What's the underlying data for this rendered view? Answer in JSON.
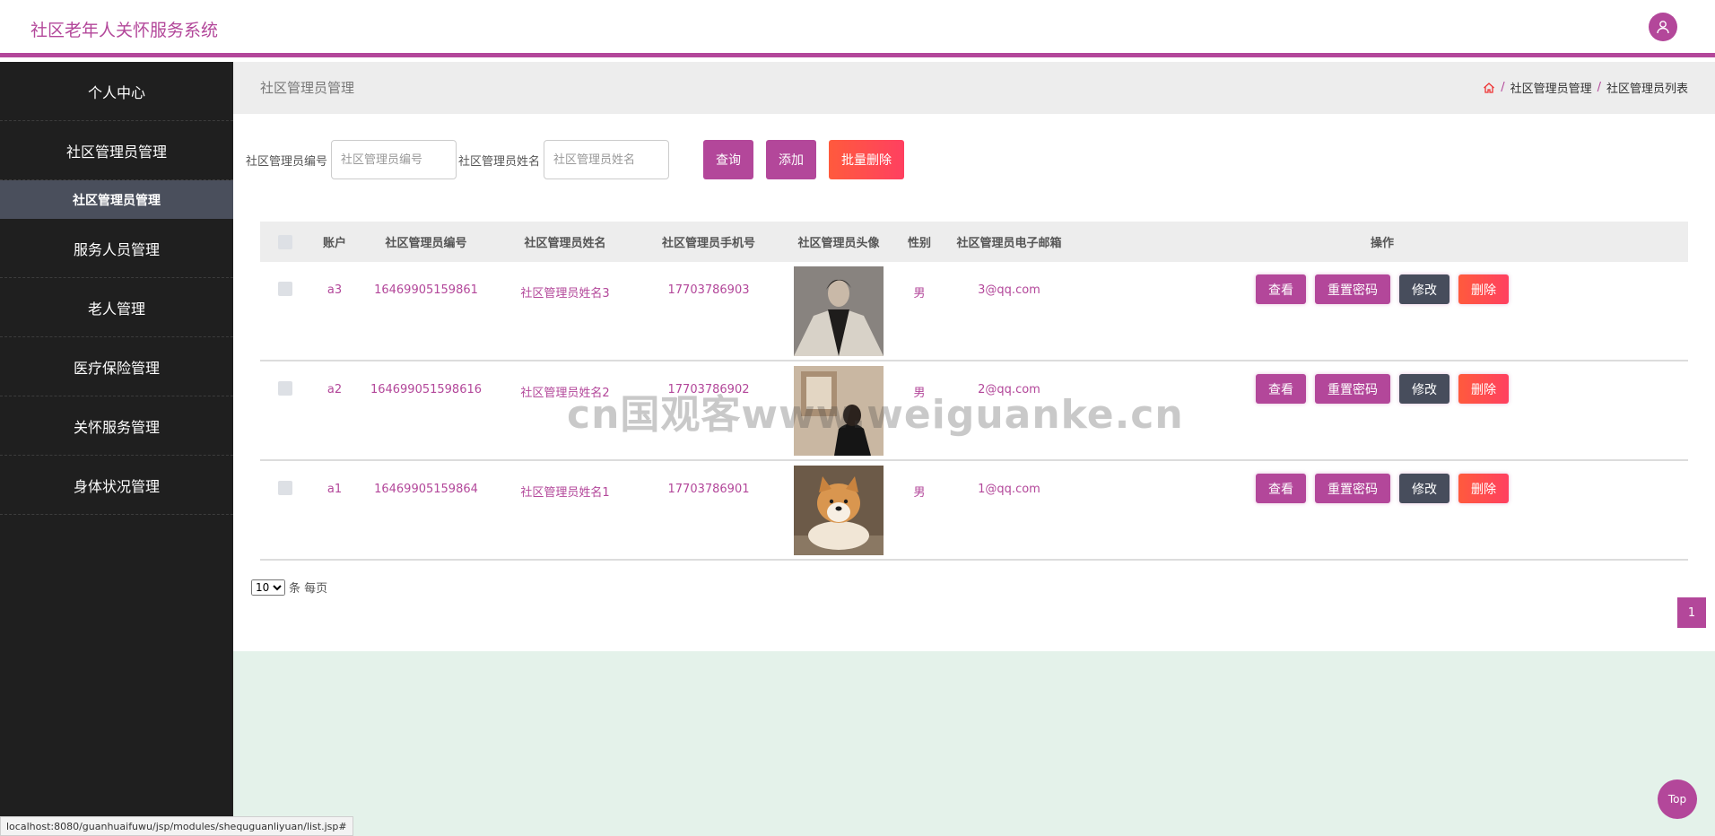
{
  "header": {
    "title": "社区老年人关怀服务系统",
    "avatar_icon": "user-icon"
  },
  "sidebar": {
    "items": [
      {
        "label": "个人中心"
      },
      {
        "label": "社区管理员管理"
      },
      {
        "label": "社区管理员管理",
        "sub": true
      },
      {
        "label": "服务人员管理"
      },
      {
        "label": "老人管理"
      },
      {
        "label": "医疗保险管理"
      },
      {
        "label": "关怀服务管理"
      },
      {
        "label": "身体状况管理"
      }
    ]
  },
  "page": {
    "title": "社区管理员管理",
    "breadcrumb": [
      "社区管理员管理",
      "社区管理员列表"
    ]
  },
  "search": {
    "no_label": "社区管理员编号",
    "no_placeholder": "社区管理员编号",
    "name_label": "社区管理员姓名",
    "name_placeholder": "社区管理员姓名",
    "query": "查询",
    "add": "添加",
    "batch_delete": "批量删除"
  },
  "table": {
    "headers": [
      "账户",
      "社区管理员编号",
      "社区管理员姓名",
      "社区管理员手机号",
      "社区管理员头像",
      "性别",
      "社区管理员电子邮箱",
      "操作"
    ],
    "rows": [
      {
        "account": "a3",
        "no": "16469905159861",
        "name": "社区管理员姓名3",
        "phone": "17703786903",
        "sex": "男",
        "email": "3@qq.com"
      },
      {
        "account": "a2",
        "no": "164699051598616",
        "name": "社区管理员姓名2",
        "phone": "17703786902",
        "sex": "男",
        "email": "2@qq.com"
      },
      {
        "account": "a1",
        "no": "16469905159864",
        "name": "社区管理员姓名1",
        "phone": "17703786901",
        "sex": "男",
        "email": "1@qq.com"
      }
    ],
    "ops": {
      "view": "查看",
      "reset": "重置密码",
      "edit": "修改",
      "delete": "删除"
    }
  },
  "pagination": {
    "page_size": "10",
    "page_size_suffix": "条 每页",
    "current_page": "1"
  },
  "watermark": "cn国观客www.weiguanke.cn",
  "status_url": "localhost:8080/guanhuaifuwu/jsp/modules/shequguanliyuan/list.jsp#",
  "top_button": "Top",
  "colors": {
    "accent": "#b3479a",
    "danger": "#ff4a4a",
    "dark_button": "#474d5c",
    "sidebar_bg": "#1f1f1f"
  }
}
